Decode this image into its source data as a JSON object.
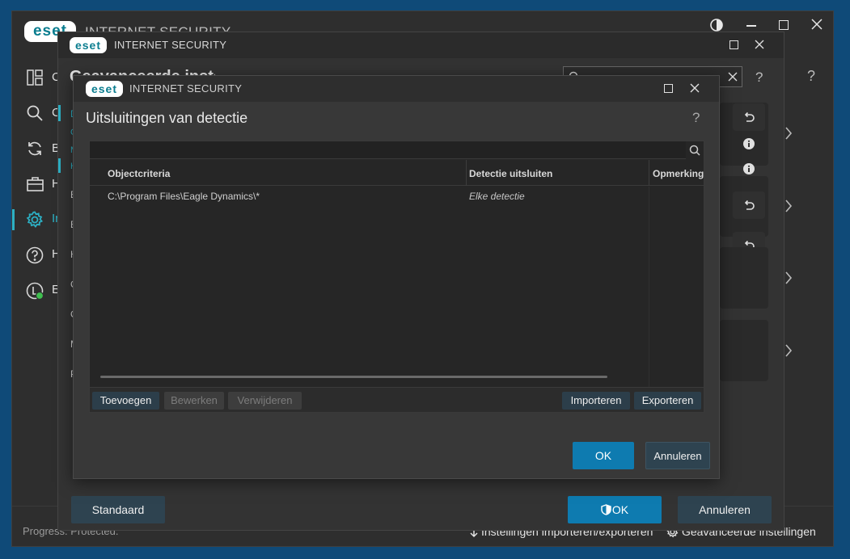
{
  "background_window": {
    "product_name": "INTERNET SECURITY",
    "logo_text": "eset",
    "nav_partial_letters": [
      "C",
      "C",
      "B",
      "H",
      "In",
      "H",
      "E"
    ],
    "submenu_partial_letters": [
      "D",
      "C",
      "M",
      "H",
      "E",
      "E",
      "H",
      "C",
      "C",
      "M",
      "P"
    ],
    "footer_left": "Progress. Protected.",
    "footer_import_export": "Instellingen importeren/exporteren",
    "footer_advanced": "Geavanceerde instellingen",
    "help_label": "?"
  },
  "middle_window": {
    "logo_text": "eset",
    "product_name": "INTERNET SECURITY",
    "partial_heading": "Geavanceerde instellingen",
    "search_placeholder": "",
    "help_label": "?",
    "standaard_label": "Standaard",
    "ok_label": "OK",
    "cancel_label": "Annuleren"
  },
  "dialog": {
    "logo_text": "eset",
    "product_name": "INTERNET SECURITY",
    "title": "Uitsluitingen van detectie",
    "help_label": "?",
    "search_placeholder": "",
    "columns": [
      "Objectcriteria",
      "Detectie uitsluiten",
      "Opmerking"
    ],
    "rows": [
      {
        "object": "C:\\Program Files\\Eagle Dynamics\\*",
        "detection": "Elke detectie",
        "comment": ""
      }
    ],
    "buttons": {
      "add": "Toevoegen",
      "edit": "Bewerken",
      "remove": "Verwijderen",
      "import": "Importeren",
      "export": "Exporteren",
      "ok": "OK",
      "cancel": "Annuleren"
    }
  },
  "colors": {
    "accent": "#0e7bb0",
    "teal": "#2cb0c4",
    "desktop": "#0f4a78",
    "status_green": "#3fbf4f"
  }
}
